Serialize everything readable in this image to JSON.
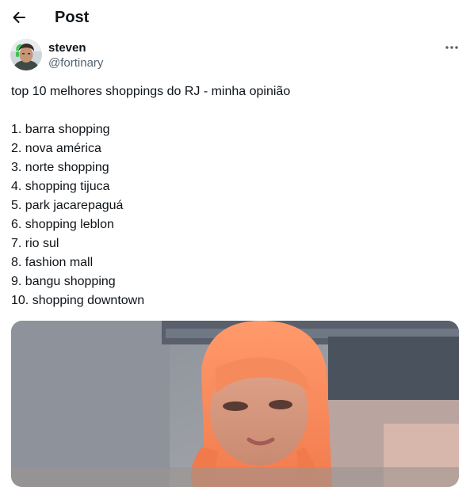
{
  "header": {
    "title": "Post",
    "back_icon": "arrow-left-icon"
  },
  "author": {
    "display_name": "steven",
    "handle": "@fortinary",
    "more_icon": "more-horizontal-icon"
  },
  "tweet": {
    "headline": "top 10 melhores shoppings do RJ - minha opinião",
    "items": [
      "1. barra shopping",
      "2. nova américa",
      "3. norte shopping",
      "4. shopping tijuca",
      "5. park jacarepaguá",
      "6. shopping leblon",
      "7. rio sul",
      "8. fashion mall",
      "9. bangu shopping",
      "10. shopping downtown"
    ]
  },
  "colors": {
    "text": "#0f1419",
    "secondary": "#536471"
  }
}
